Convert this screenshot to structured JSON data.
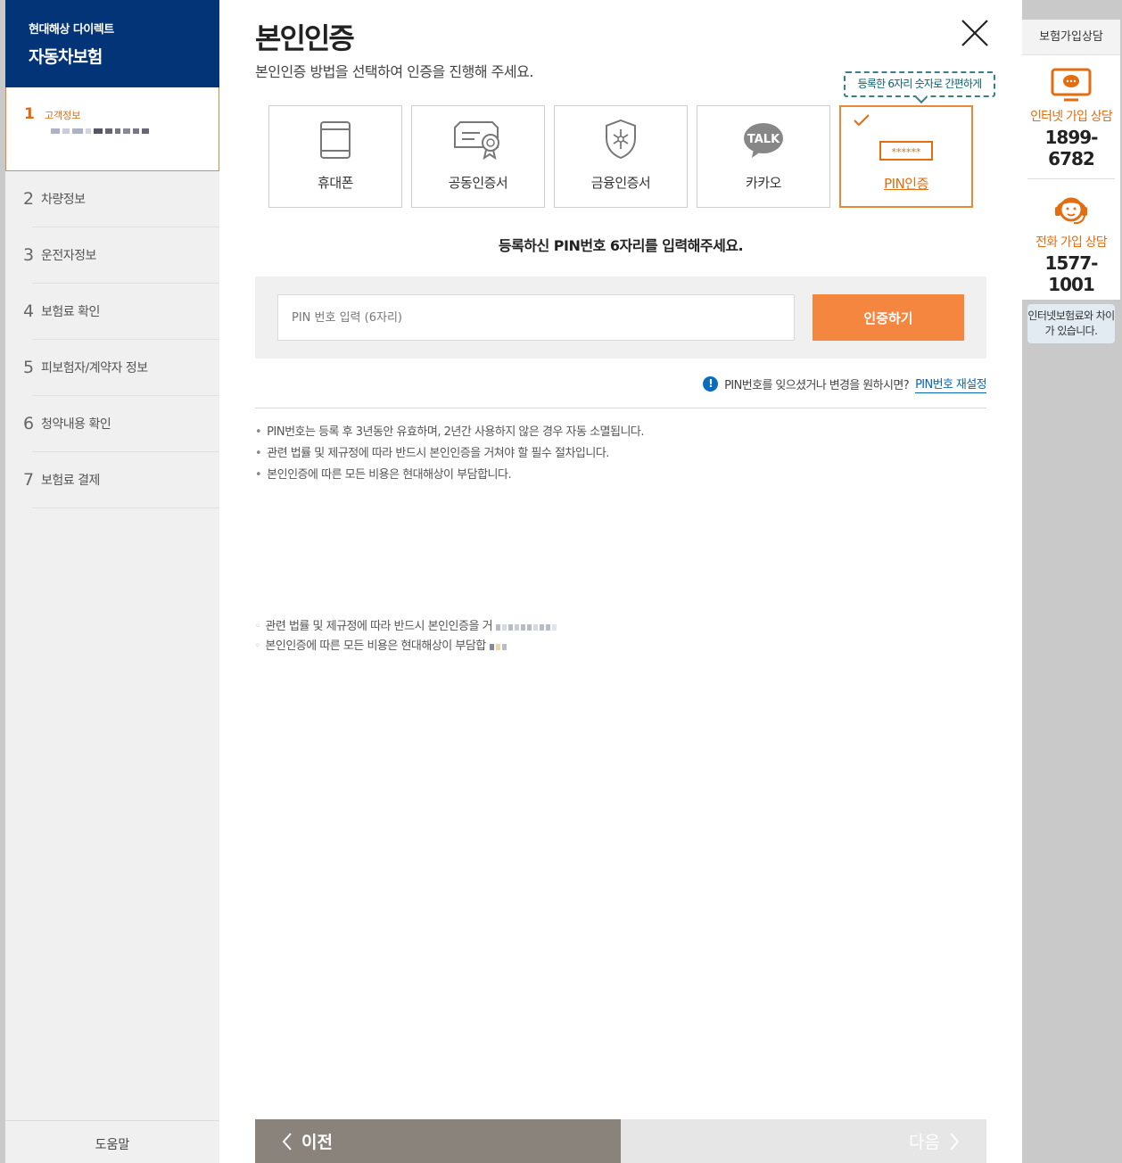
{
  "sidebar": {
    "brand_line1": "현대해상 다이렉트",
    "brand_line2": "자동차보험",
    "active_step": {
      "num": "1",
      "label": "고객정보"
    },
    "steps": [
      {
        "num": "2",
        "label": "차량정보"
      },
      {
        "num": "3",
        "label": "운전자정보"
      },
      {
        "num": "4",
        "label": "보험료 확인"
      },
      {
        "num": "5",
        "label": "피보험자/계약자 정보"
      },
      {
        "num": "6",
        "label": "청약내용 확인"
      },
      {
        "num": "7",
        "label": "보험료 결제"
      }
    ],
    "help_label": "도움말"
  },
  "main": {
    "title": "본인인증",
    "subtitle": "본인인증 방법을 선택하여 인증을 진행해 주세요.",
    "tooltip": "등록한 6자리 숫자로 간편하게",
    "methods": [
      {
        "label": "휴대폰",
        "icon": "phone-icon"
      },
      {
        "label": "공동인증서",
        "icon": "certificate-icon"
      },
      {
        "label": "금융인증서",
        "icon": "finance-cert-icon"
      },
      {
        "label": "카카오",
        "icon": "kakao-talk-icon"
      },
      {
        "label": "PIN인증",
        "icon": "pin-icon",
        "selected": true
      }
    ],
    "kakao_icon_text": "TALK",
    "pin_icon_text": "******",
    "instruction": "등록하신 PIN번호 6자리를 입력해주세요.",
    "pin_placeholder": "PIN 번호 입력 (6자리)",
    "pin_button": "인증하기",
    "forgot_text": "PIN번호를 잊으셨거나 변경을 원하시면?",
    "forgot_link": "PIN번호 재설정",
    "notes": [
      "PIN번호는 등록 후 3년동안 유효하며, 2년간 사용하지 않은 경우 자동 소멸됩니다.",
      "관련 법률 및 제규정에 따라 반드시 본인인증을 거쳐야 할 필수 절차입니다.",
      "본인인증에 따른 모든 비용은 현대해상이 부담합니다."
    ],
    "notes_background": [
      "관련 법률 및 제규정에 따라 반드시 본인인증을 거",
      "본인인증에 따른 모든 비용은 현대해상이 부담합"
    ],
    "prev_label": "이전",
    "next_label": "다음"
  },
  "right_panel": {
    "header": "보험가입상담",
    "internet_label": "인터넷 가입 상담",
    "internet_phone": "1899-6782",
    "phone_label": "전화 가입 상담",
    "phone_number": "1577-1001",
    "note": "인터넷보험료와 차이가 있습니다."
  },
  "colors": {
    "brand": "#033477",
    "accent": "#f4863f",
    "selected_border": "#e8893a",
    "link": "#0a67b6"
  }
}
